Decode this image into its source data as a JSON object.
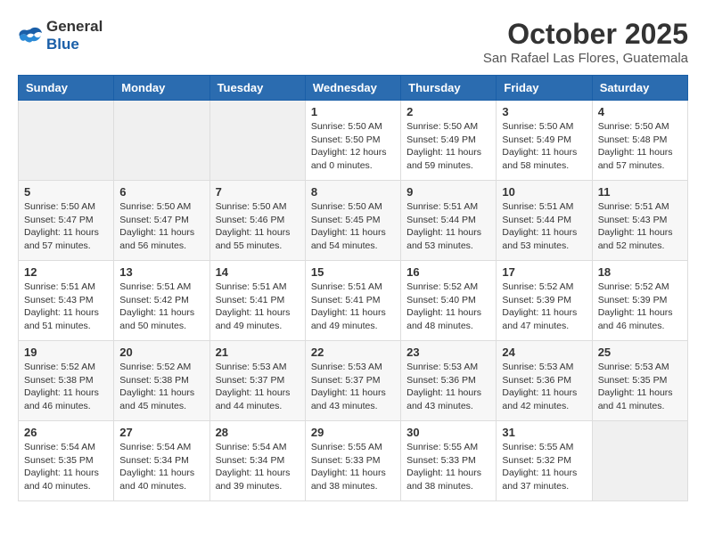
{
  "header": {
    "logo_general": "General",
    "logo_blue": "Blue",
    "month_title": "October 2025",
    "location": "San Rafael Las Flores, Guatemala"
  },
  "weekdays": [
    "Sunday",
    "Monday",
    "Tuesday",
    "Wednesday",
    "Thursday",
    "Friday",
    "Saturday"
  ],
  "weeks": [
    [
      {
        "day": "",
        "info": ""
      },
      {
        "day": "",
        "info": ""
      },
      {
        "day": "",
        "info": ""
      },
      {
        "day": "1",
        "info": "Sunrise: 5:50 AM\nSunset: 5:50 PM\nDaylight: 12 hours\nand 0 minutes."
      },
      {
        "day": "2",
        "info": "Sunrise: 5:50 AM\nSunset: 5:49 PM\nDaylight: 11 hours\nand 59 minutes."
      },
      {
        "day": "3",
        "info": "Sunrise: 5:50 AM\nSunset: 5:49 PM\nDaylight: 11 hours\nand 58 minutes."
      },
      {
        "day": "4",
        "info": "Sunrise: 5:50 AM\nSunset: 5:48 PM\nDaylight: 11 hours\nand 57 minutes."
      }
    ],
    [
      {
        "day": "5",
        "info": "Sunrise: 5:50 AM\nSunset: 5:47 PM\nDaylight: 11 hours\nand 57 minutes."
      },
      {
        "day": "6",
        "info": "Sunrise: 5:50 AM\nSunset: 5:47 PM\nDaylight: 11 hours\nand 56 minutes."
      },
      {
        "day": "7",
        "info": "Sunrise: 5:50 AM\nSunset: 5:46 PM\nDaylight: 11 hours\nand 55 minutes."
      },
      {
        "day": "8",
        "info": "Sunrise: 5:50 AM\nSunset: 5:45 PM\nDaylight: 11 hours\nand 54 minutes."
      },
      {
        "day": "9",
        "info": "Sunrise: 5:51 AM\nSunset: 5:44 PM\nDaylight: 11 hours\nand 53 minutes."
      },
      {
        "day": "10",
        "info": "Sunrise: 5:51 AM\nSunset: 5:44 PM\nDaylight: 11 hours\nand 53 minutes."
      },
      {
        "day": "11",
        "info": "Sunrise: 5:51 AM\nSunset: 5:43 PM\nDaylight: 11 hours\nand 52 minutes."
      }
    ],
    [
      {
        "day": "12",
        "info": "Sunrise: 5:51 AM\nSunset: 5:43 PM\nDaylight: 11 hours\nand 51 minutes."
      },
      {
        "day": "13",
        "info": "Sunrise: 5:51 AM\nSunset: 5:42 PM\nDaylight: 11 hours\nand 50 minutes."
      },
      {
        "day": "14",
        "info": "Sunrise: 5:51 AM\nSunset: 5:41 PM\nDaylight: 11 hours\nand 49 minutes."
      },
      {
        "day": "15",
        "info": "Sunrise: 5:51 AM\nSunset: 5:41 PM\nDaylight: 11 hours\nand 49 minutes."
      },
      {
        "day": "16",
        "info": "Sunrise: 5:52 AM\nSunset: 5:40 PM\nDaylight: 11 hours\nand 48 minutes."
      },
      {
        "day": "17",
        "info": "Sunrise: 5:52 AM\nSunset: 5:39 PM\nDaylight: 11 hours\nand 47 minutes."
      },
      {
        "day": "18",
        "info": "Sunrise: 5:52 AM\nSunset: 5:39 PM\nDaylight: 11 hours\nand 46 minutes."
      }
    ],
    [
      {
        "day": "19",
        "info": "Sunrise: 5:52 AM\nSunset: 5:38 PM\nDaylight: 11 hours\nand 46 minutes."
      },
      {
        "day": "20",
        "info": "Sunrise: 5:52 AM\nSunset: 5:38 PM\nDaylight: 11 hours\nand 45 minutes."
      },
      {
        "day": "21",
        "info": "Sunrise: 5:53 AM\nSunset: 5:37 PM\nDaylight: 11 hours\nand 44 minutes."
      },
      {
        "day": "22",
        "info": "Sunrise: 5:53 AM\nSunset: 5:37 PM\nDaylight: 11 hours\nand 43 minutes."
      },
      {
        "day": "23",
        "info": "Sunrise: 5:53 AM\nSunset: 5:36 PM\nDaylight: 11 hours\nand 43 minutes."
      },
      {
        "day": "24",
        "info": "Sunrise: 5:53 AM\nSunset: 5:36 PM\nDaylight: 11 hours\nand 42 minutes."
      },
      {
        "day": "25",
        "info": "Sunrise: 5:53 AM\nSunset: 5:35 PM\nDaylight: 11 hours\nand 41 minutes."
      }
    ],
    [
      {
        "day": "26",
        "info": "Sunrise: 5:54 AM\nSunset: 5:35 PM\nDaylight: 11 hours\nand 40 minutes."
      },
      {
        "day": "27",
        "info": "Sunrise: 5:54 AM\nSunset: 5:34 PM\nDaylight: 11 hours\nand 40 minutes."
      },
      {
        "day": "28",
        "info": "Sunrise: 5:54 AM\nSunset: 5:34 PM\nDaylight: 11 hours\nand 39 minutes."
      },
      {
        "day": "29",
        "info": "Sunrise: 5:55 AM\nSunset: 5:33 PM\nDaylight: 11 hours\nand 38 minutes."
      },
      {
        "day": "30",
        "info": "Sunrise: 5:55 AM\nSunset: 5:33 PM\nDaylight: 11 hours\nand 38 minutes."
      },
      {
        "day": "31",
        "info": "Sunrise: 5:55 AM\nSunset: 5:32 PM\nDaylight: 11 hours\nand 37 minutes."
      },
      {
        "day": "",
        "info": ""
      }
    ]
  ]
}
